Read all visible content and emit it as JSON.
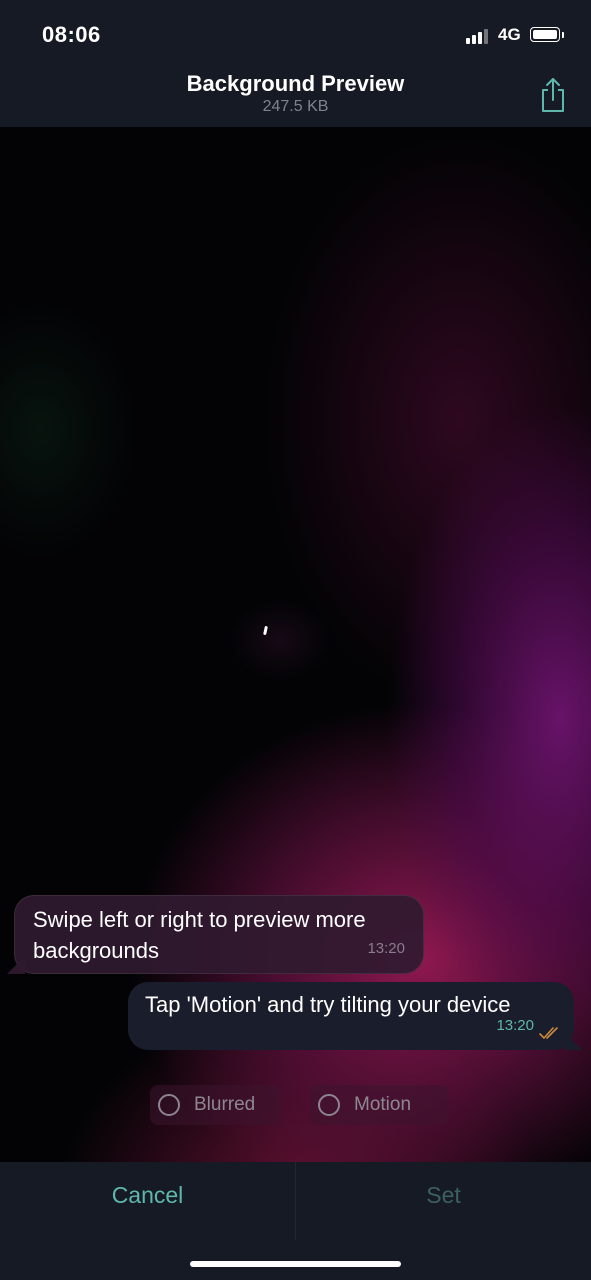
{
  "status_bar": {
    "time": "08:06",
    "network": "4G",
    "battery_level": 1.0
  },
  "header": {
    "title": "Background Preview",
    "subtitle": "247.5 KB",
    "share_icon": "share-icon"
  },
  "messages": [
    {
      "direction": "incoming",
      "text": "Swipe left or right to preview more backgrounds",
      "time": "13:20"
    },
    {
      "direction": "outgoing",
      "text": "Tap 'Motion' and try tilting your device",
      "time": "13:20",
      "status": "read"
    }
  ],
  "options": [
    {
      "label": "Blurred",
      "checked": false
    },
    {
      "label": "Motion",
      "checked": false
    }
  ],
  "footer": {
    "cancel_label": "Cancel",
    "set_label": "Set"
  },
  "colors": {
    "accent": "#5fb7ac",
    "bar_background": "#161a24",
    "disabled": "#3c5f61"
  }
}
